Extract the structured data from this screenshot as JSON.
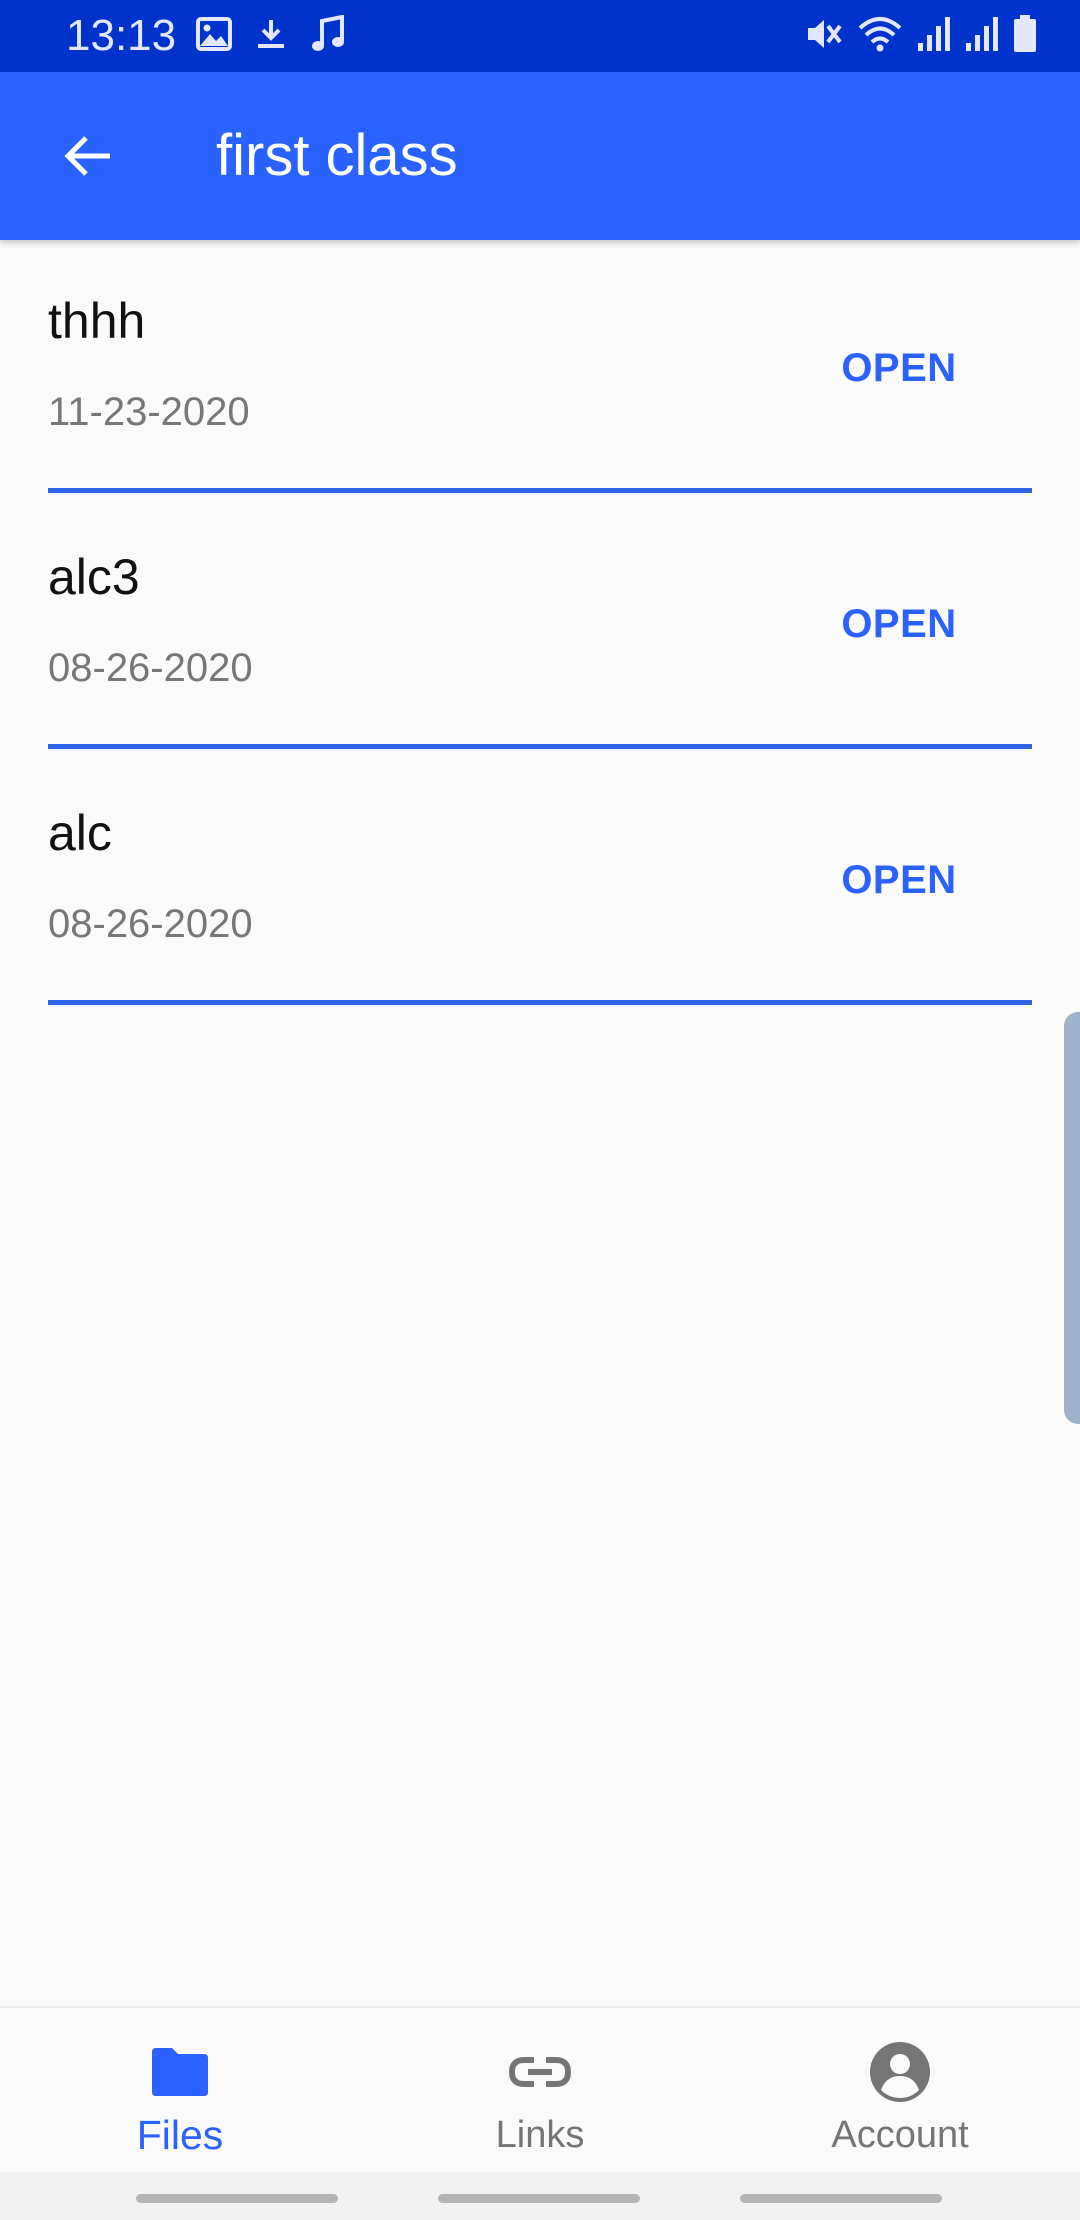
{
  "status_bar": {
    "time": "13:13",
    "left_icons": [
      "image-icon",
      "download-icon",
      "music-note-icon"
    ],
    "right_icons": [
      "mute-icon",
      "wifi-icon",
      "signal-icon",
      "signal-icon",
      "battery-icon"
    ],
    "background": "#0033cc"
  },
  "app_bar": {
    "title": "first class",
    "back_icon": "arrow-back-icon",
    "background": "#2962ff"
  },
  "files": [
    {
      "name": "thhh",
      "date": "11-23-2020",
      "action": "OPEN"
    },
    {
      "name": "alc3",
      "date": "08-26-2020",
      "action": "OPEN"
    },
    {
      "name": "alc",
      "date": "08-26-2020",
      "action": "OPEN"
    }
  ],
  "bottom_nav": {
    "items": [
      {
        "label": "Files",
        "icon": "folder-icon",
        "active": true
      },
      {
        "label": "Links",
        "icon": "link-icon",
        "active": false
      },
      {
        "label": "Account",
        "icon": "account-circle-icon",
        "active": false
      }
    ]
  },
  "colors": {
    "accent": "#2962ff",
    "divider": "#2e64e6",
    "text_primary": "#111111",
    "text_secondary": "#777777",
    "nav_inactive": "#757575"
  }
}
